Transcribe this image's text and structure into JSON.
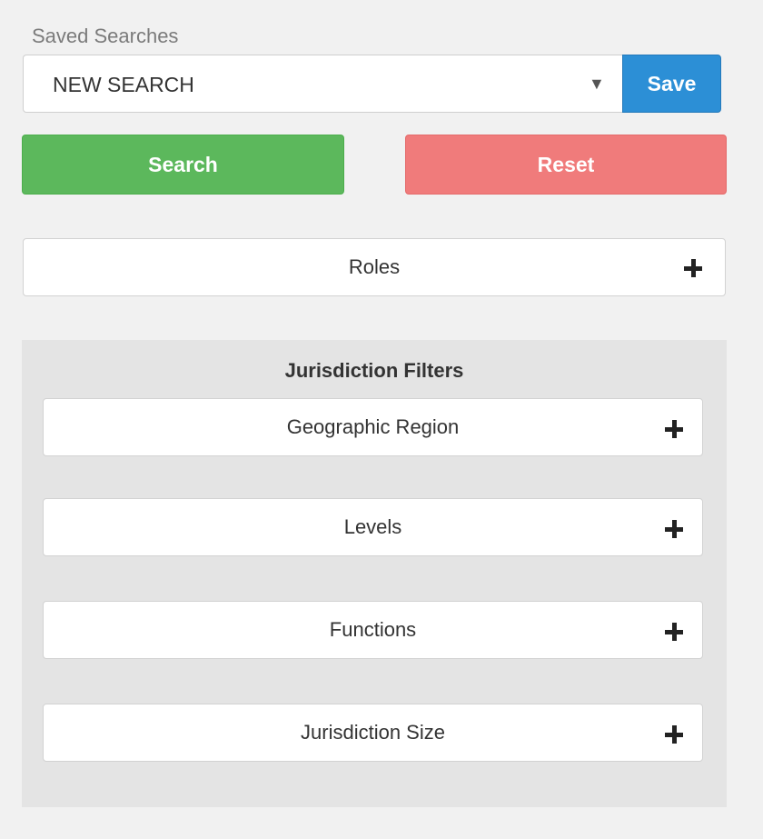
{
  "saved_searches": {
    "label": "Saved Searches",
    "selected_value": "NEW SEARCH",
    "caret": "▼",
    "save_label": "Save"
  },
  "actions": {
    "search_label": "Search",
    "reset_label": "Reset"
  },
  "roles": {
    "label": "Roles",
    "icon": "plus-icon"
  },
  "jurisdiction_filters": {
    "title": "Jurisdiction Filters",
    "items": [
      {
        "label": "Geographic Region",
        "icon": "plus-icon"
      },
      {
        "label": "Levels",
        "icon": "plus-icon"
      },
      {
        "label": "Functions",
        "icon": "plus-icon"
      },
      {
        "label": "Jurisdiction Size",
        "icon": "plus-icon"
      }
    ]
  },
  "colors": {
    "save": "#2c8fd6",
    "search": "#5cb85c",
    "reset": "#f07b7b",
    "filter_panel": "#e4e4e4"
  }
}
